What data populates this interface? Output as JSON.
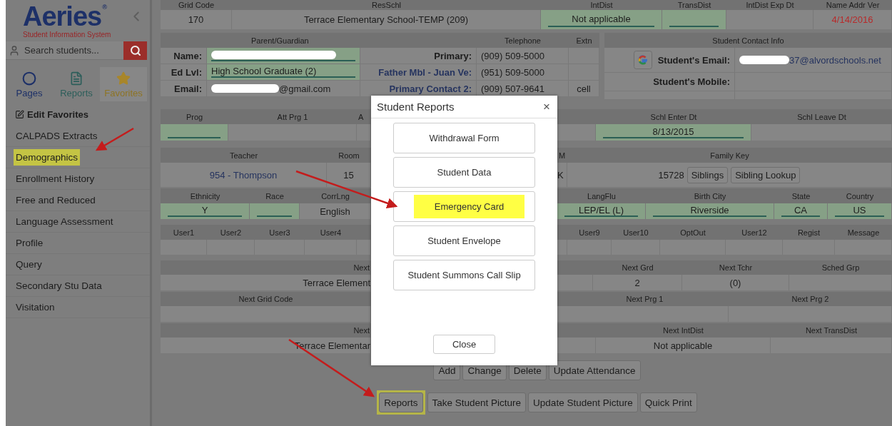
{
  "sidebar": {
    "logo": "Aeries",
    "logo_mark": "®",
    "tagline": "Student Information System",
    "search": {
      "placeholder": "Search students..."
    },
    "tabs": [
      {
        "label": "Pages",
        "selected": false
      },
      {
        "label": "Reports",
        "selected": false
      },
      {
        "label": "Favorites",
        "selected": true
      }
    ],
    "edit_favorites": "Edit Favorites",
    "items": [
      {
        "label": "CALPADS Extracts",
        "highlighted": false
      },
      {
        "label": "Demographics",
        "highlighted": true
      },
      {
        "label": "Enrollment History",
        "highlighted": false
      },
      {
        "label": "Free and Reduced",
        "highlighted": false
      },
      {
        "label": "Language Assessment",
        "highlighted": false
      },
      {
        "label": "Profile",
        "highlighted": false
      },
      {
        "label": "Query",
        "highlighted": false
      },
      {
        "label": "Secondary Stu Data",
        "highlighted": false
      },
      {
        "label": "Visitation",
        "highlighted": false
      }
    ]
  },
  "top_row": [
    {
      "header": "Grid Code",
      "value": "170",
      "field": false
    },
    {
      "header": "ResSchl",
      "value": "Terrace Elementary School-TEMP (209)",
      "field": false
    },
    {
      "header": "IntDist",
      "value": "Not applicable",
      "field": true
    },
    {
      "header": "TransDist",
      "field": true
    },
    {
      "header": "IntDist Exp Dt",
      "field": false
    },
    {
      "header": "Name Addr Ver",
      "value": "4/14/2016",
      "field": false,
      "alert": true
    }
  ],
  "guardian": {
    "title": "Parent/Guardian",
    "phone_header": "Telephone",
    "ext_header": "Extn",
    "rows": [
      {
        "label": "Name:",
        "redacted": true,
        "field": true,
        "phone_label": "Primary:",
        "link": false,
        "phone": "(909) 509-5000"
      },
      {
        "label": "Ed Lvl:",
        "value": "High School Graduate (2)",
        "redacted": false,
        "field": true,
        "phone_label": "Father Mbl - Juan Ve:",
        "link": true,
        "phone": "(951) 509-5000"
      },
      {
        "label": "Email:",
        "value": "@gmail.com",
        "redacted": true,
        "field": false,
        "phone_label": "Primary Contact 2:",
        "link": true,
        "phone": "(909) 507-9641",
        "ext": "cell"
      }
    ]
  },
  "contact": {
    "title": "Student Contact Info",
    "rows": [
      {
        "label": "Student's Email:",
        "value": "37@alvordschools.net",
        "redacted": true,
        "google": true
      },
      {
        "label": "Student's Mobile:",
        "redacted": false,
        "google": false
      }
    ]
  },
  "sections": [
    {
      "left": [
        {
          "header": "Prog",
          "field": true
        },
        {
          "header": "Att Prg 1",
          "field": false
        },
        {
          "header": "A",
          "field": false
        }
      ],
      "right": [
        {
          "header": "Schl Enter Dt",
          "value": "8/13/2015",
          "field": true
        },
        {
          "header": "Schl Leave Dt",
          "field": false
        }
      ]
    },
    {
      "left": [
        {
          "header": "Teacher",
          "value": "954 - Thompson",
          "link": true,
          "field": false
        },
        {
          "header": "Room",
          "value": "15",
          "field": false
        }
      ],
      "right": [
        {
          "header": "M",
          "value": "K",
          "field": false
        },
        {
          "header": "Family Key",
          "value": "15728",
          "buttons": [
            "Siblings",
            "Sibling Lookup"
          ],
          "field": false
        }
      ]
    },
    {
      "left": [
        {
          "header": "Ethnicity",
          "value": "Y",
          "field": true
        },
        {
          "header": "Race",
          "field": true
        },
        {
          "header": "CorrLng",
          "value": "English",
          "field": false
        }
      ],
      "right": [
        {
          "header": "LangFlu",
          "value": "LEP/EL (L)",
          "field": true
        },
        {
          "header": "Birth City",
          "value": "Riverside",
          "field": true
        },
        {
          "header": "State",
          "value": "CA",
          "field": true
        },
        {
          "header": "Country",
          "value": "US",
          "field": true
        }
      ]
    },
    {
      "left": [
        {
          "header": "User1",
          "field": false
        },
        {
          "header": "User2",
          "field": false
        },
        {
          "header": "User3",
          "field": false
        },
        {
          "header": "User4",
          "field": false
        }
      ],
      "right": [
        {
          "header": "User9",
          "field": false
        },
        {
          "header": "User10",
          "field": false
        },
        {
          "header": "OptOut",
          "field": false
        },
        {
          "header": "User12",
          "field": false
        },
        {
          "header": "Regist",
          "field": false
        },
        {
          "header": "Message",
          "field": false
        }
      ]
    },
    {
      "left": [
        {
          "header": "Next",
          "value": "Terrace Element",
          "field": false
        }
      ],
      "right": [
        {
          "header": "Next Grd",
          "value": "2",
          "field": false
        },
        {
          "header": "Next Tchr",
          "value": "(0)",
          "field": false
        },
        {
          "header": "Sched Grp",
          "field": false
        }
      ]
    },
    {
      "left": [
        {
          "header": "Next Grid Code",
          "field": false
        }
      ],
      "right": [
        {
          "header": "Next Prg 1",
          "field": false
        },
        {
          "header": "Next Prg 2",
          "field": false
        }
      ]
    },
    {
      "left": [
        {
          "header": "Next",
          "value": "Terrace Elementar",
          "field": false
        }
      ],
      "right": [
        {
          "header": "Next IntDist",
          "value": "Not applicable",
          "field": false
        },
        {
          "header": "Next TransDist",
          "field": false
        }
      ]
    }
  ],
  "actions": [
    {
      "buttons": [
        {
          "label": "Add",
          "highlighted": false
        },
        {
          "label": "Change",
          "highlighted": false
        },
        {
          "label": "Delete",
          "highlighted": false
        },
        {
          "label": "Update Attendance",
          "highlighted": false
        }
      ]
    },
    {
      "buttons": [
        {
          "label": "Reports",
          "highlighted": true
        },
        {
          "label": "Take Student Picture",
          "highlighted": false
        },
        {
          "label": "Update Student Picture",
          "highlighted": false
        },
        {
          "label": "Quick Print",
          "highlighted": false
        }
      ]
    }
  ],
  "dialog": {
    "title": "Student Reports",
    "close_icon": "×",
    "reports": [
      {
        "label": "Withdrawal Form",
        "highlighted": false
      },
      {
        "label": "Student Data",
        "highlighted": false
      },
      {
        "label": "Emergency Card",
        "highlighted": true
      },
      {
        "label": "Student Envelope",
        "highlighted": false
      },
      {
        "label": "Student Summons Call Slip",
        "highlighted": false
      }
    ],
    "close_button": "Close"
  }
}
